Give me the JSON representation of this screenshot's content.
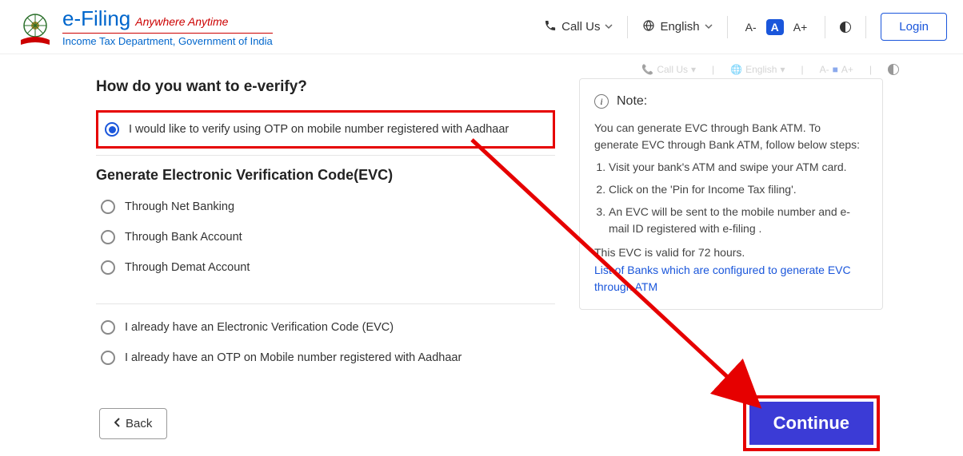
{
  "header": {
    "brand_title": "e-Filing",
    "tagline": "Anywhere Anytime",
    "dept": "Income Tax Department, Government of India",
    "call_us": "Call Us",
    "language": "English",
    "login": "Login",
    "text_small": "A-",
    "text_mid": "A",
    "text_large": "A+"
  },
  "ghost": {
    "call": "Call Us",
    "lang": "English"
  },
  "question": "How do you want to e-verify?",
  "opt_aadhaar": "I would like to verify using OTP on mobile number registered with Aadhaar",
  "evc_title": "Generate Electronic Verification Code(EVC)",
  "opt_netbank": "Through Net Banking",
  "opt_bankacc": "Through Bank Account",
  "opt_demat": "Through Demat Account",
  "opt_have_evc": "I already have an Electronic Verification Code (EVC)",
  "opt_have_otp": "I already have an OTP on Mobile number registered with Aadhaar",
  "note": {
    "title": "Note:",
    "intro": "You can generate EVC through Bank ATM. To generate EVC through Bank ATM, follow below steps:",
    "step1": "Visit your bank's ATM and swipe your ATM card.",
    "step2": "Click on the 'Pin for Income Tax filing'.",
    "step3": "An EVC will be sent to the mobile number and e-mail ID registered with e-filing .",
    "validity": "This EVC is valid for 72 hours.",
    "link": "List of Banks which are configured to generate EVC through ATM"
  },
  "buttons": {
    "back": "Back",
    "continue": "Continue"
  }
}
